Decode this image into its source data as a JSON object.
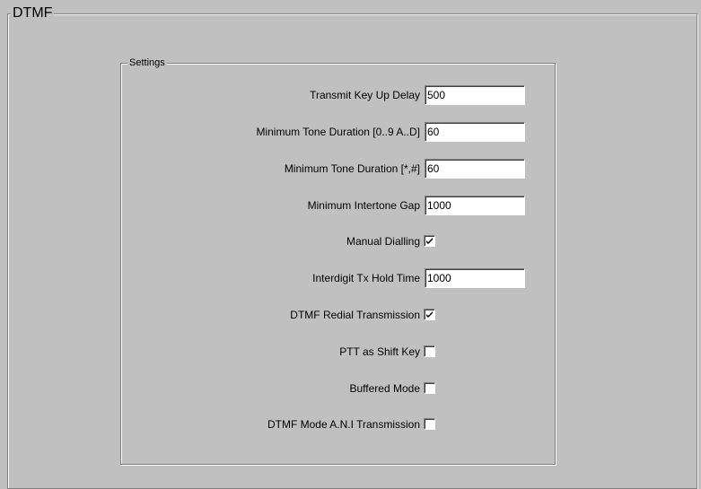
{
  "section": {
    "title": "DTMF",
    "group_title": "Settings"
  },
  "fields": {
    "transmit_key_up_delay": {
      "label": "Transmit Key Up Delay",
      "value": "500"
    },
    "min_tone_duration_digits": {
      "label": "Minimum Tone Duration [0..9 A..D]",
      "value": "60"
    },
    "min_tone_duration_symbols": {
      "label": "Minimum Tone Duration [*,#]",
      "value": "60"
    },
    "min_intertone_gap": {
      "label": "Minimum Intertone Gap",
      "value": "1000"
    },
    "manual_dialling": {
      "label": "Manual Dialling",
      "checked": true
    },
    "interdigit_tx_hold_time": {
      "label": "Interdigit Tx Hold Time",
      "value": "1000"
    },
    "dtmf_redial_transmission": {
      "label": "DTMF Redial Transmission",
      "checked": true
    },
    "ptt_as_shift_key": {
      "label": "PTT as Shift Key",
      "checked": false
    },
    "buffered_mode": {
      "label": "Buffered Mode",
      "checked": false
    },
    "dtmf_mode_ani_transmission": {
      "label": "DTMF Mode A.N.I Transmission",
      "checked": false
    }
  }
}
